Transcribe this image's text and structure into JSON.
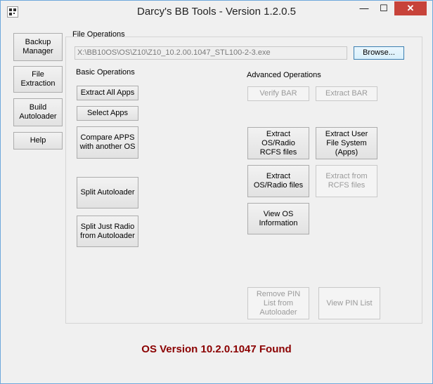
{
  "window": {
    "title": "Darcy's BB Tools - Version 1.2.0.5",
    "controls": {
      "minimize": "—",
      "maximize": "☐",
      "close": "✕"
    }
  },
  "sidebar": {
    "items": [
      {
        "label": "Backup\nManager"
      },
      {
        "label": "File\nExtraction"
      },
      {
        "label": "Build\nAutoloader"
      },
      {
        "label": "Help"
      }
    ]
  },
  "file_operations": {
    "section_label": "File Operations",
    "path_value": "X:\\BB10OS\\OS\\Z10\\Z10_10.2.00.1047_STL100-2-3.exe",
    "browse_label": "Browse..."
  },
  "basic_operations": {
    "label": "Basic Operations",
    "extract_all_apps": "Extract All Apps",
    "select_apps": "Select Apps",
    "compare_apps": "Compare APPS\nwith another OS",
    "split_autoloader": "Split Autoloader",
    "split_radio": "Split Just Radio\nfrom Autoloader"
  },
  "advanced_operations": {
    "label": "Advanced Operations",
    "verify_bar": "Verify BAR",
    "extract_bar": "Extract BAR",
    "extract_os_radio_rcfs": "Extract\nOS/Radio\nRCFS files",
    "extract_user_fs": "Extract User\nFile System\n(Apps)",
    "extract_os_radio_files": "Extract\nOS/Radio files",
    "extract_from_rcfs": "Extract from\nRCFS files",
    "view_os_info": "View OS\nInformation",
    "remove_pin_list": "Remove PIN\nList from\nAutoloader",
    "view_pin_list": "View PIN List"
  },
  "status": {
    "text": "OS Version 10.2.0.1047 Found",
    "color": "#8b0000"
  }
}
